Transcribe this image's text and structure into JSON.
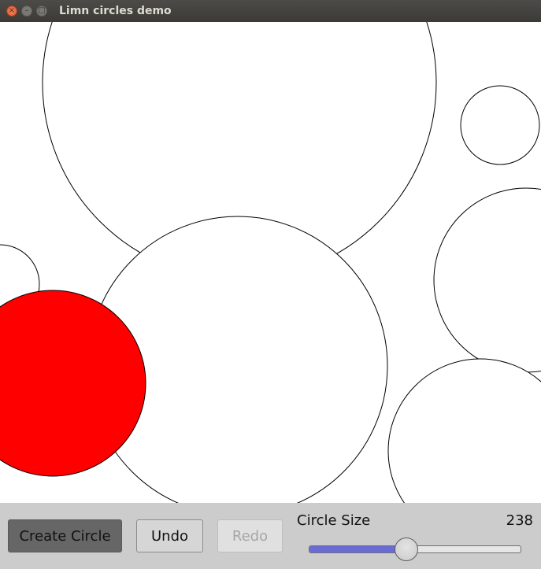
{
  "window": {
    "title": "Limn circles demo",
    "close_glyph": "×",
    "minimize_glyph": "–",
    "maximize_glyph": "□"
  },
  "canvas": {
    "background": "#ffffff",
    "circles": [
      {
        "fill": "none",
        "selected": false
      },
      {
        "fill": "none",
        "selected": false
      },
      {
        "fill": "none",
        "selected": false
      },
      {
        "fill": "none",
        "selected": false
      },
      {
        "fill": "none",
        "selected": false
      },
      {
        "fill": "none",
        "selected": false
      },
      {
        "fill": "#ff0000",
        "selected": true
      }
    ]
  },
  "controls": {
    "create_label": "Create Circle",
    "undo_label": "Undo",
    "redo_label": "Redo",
    "size_label": "Circle Size",
    "size_value": "238",
    "slider_fraction": 0.46
  },
  "colors": {
    "selected_fill": "#ff0000",
    "slider_fill": "#6b6bd6",
    "create_button_bg": "#666666"
  }
}
